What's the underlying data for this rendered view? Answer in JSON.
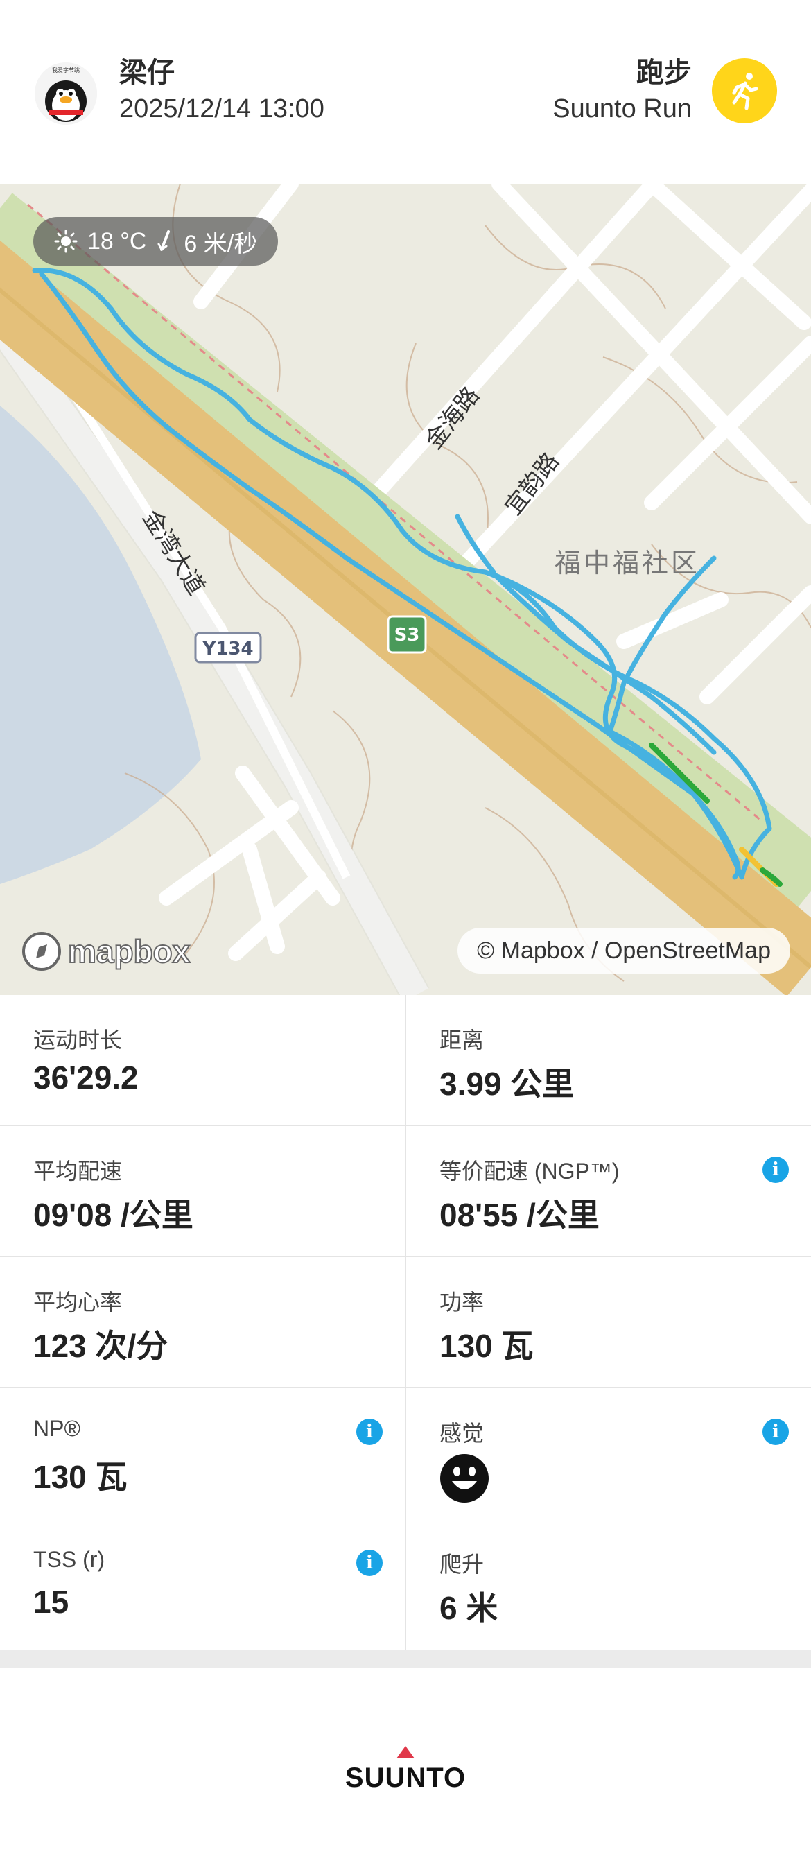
{
  "header": {
    "user_name": "梁仔",
    "datetime": "2025/12/14 13:00",
    "sport_name": "跑步",
    "app_name": "Suunto Run",
    "avatar_icon": "penguin-avatar-icon",
    "sport_icon": "runner-icon",
    "badge_color": "#ffd51a"
  },
  "map": {
    "weather": {
      "temperature": "18 °C",
      "wind": "6 米/秒"
    },
    "labels": {
      "road_jinhai": "金海路",
      "road_guiyun": "宜韵路",
      "road_jinwan": "金湾大道",
      "district": "福中福社区",
      "route_y134": "Y134",
      "route_s3": "S3"
    },
    "logo_text": "mapbox",
    "attribution": "© Mapbox / OpenStreetMap",
    "track_color": "#46b2e0"
  },
  "stats": [
    {
      "label": "运动时长",
      "value": "36'29.2"
    },
    {
      "label": "距离",
      "value": "3.99 公里"
    },
    {
      "label": "平均配速",
      "value": "09'08 /公里"
    },
    {
      "label": "等价配速 (NGP™)",
      "value": "08'55 /公里",
      "info": true
    },
    {
      "label": "平均心率",
      "value": "123 次/分"
    },
    {
      "label": "功率",
      "value": "130 瓦"
    },
    {
      "label": "NP®",
      "value": "130 瓦",
      "info": true
    },
    {
      "label": "感觉",
      "value": "",
      "info": true,
      "icon": "smiley-face-icon"
    },
    {
      "label": "TSS (r)",
      "value": "15",
      "info": true
    },
    {
      "label": "爬升",
      "value": "6 米"
    }
  ],
  "footer": {
    "brand": "SUUNTO",
    "accent": "#e0384a"
  }
}
